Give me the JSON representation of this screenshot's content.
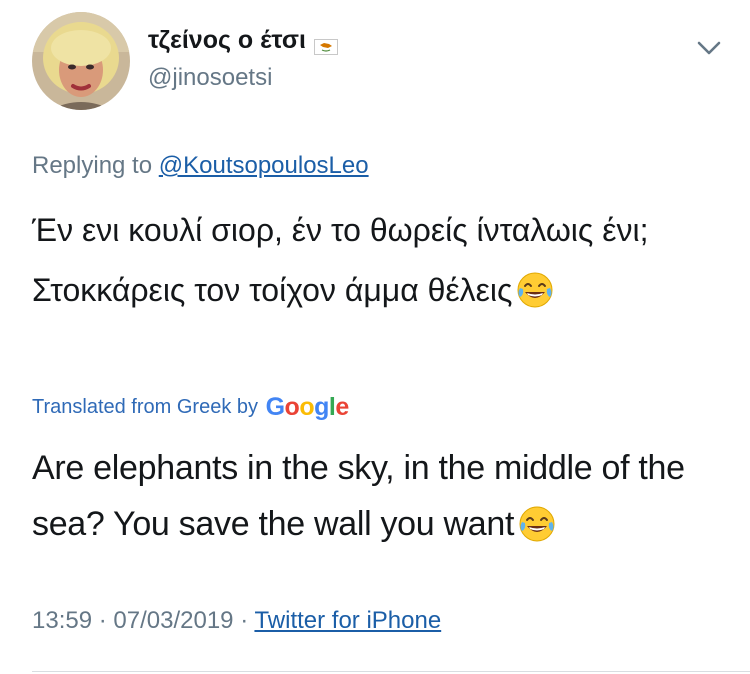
{
  "author": {
    "display_name": "τζείνος ο έτσι",
    "handle": "@jinosoetsi",
    "avatar_icon": "user-avatar",
    "flag_icon": "cyprus-flag-icon"
  },
  "menu": {
    "icon": "chevron-down-icon"
  },
  "reply": {
    "prefix": "Replying to",
    "to_handle": "@KoutsopoulosLeo"
  },
  "tweet": {
    "text": "Έν ενι κουλί σιορ, έν το θωρείς ίνταλωις ένι; Στοκκάρεις τον τοίχον άμμα θέλεις",
    "emoji_icon": "face-with-tears-of-joy-emoji"
  },
  "translation": {
    "label": "Translated from Greek by",
    "provider": "Google",
    "text": "Are elephants in the sky, in the middle of the sea? You save the wall you want",
    "emoji_icon": "face-with-tears-of-joy-emoji"
  },
  "meta": {
    "time": "13:59",
    "date": "07/03/2019",
    "separator": "·",
    "source": "Twitter for iPhone"
  },
  "colors": {
    "text": "#14171a",
    "secondary": "#657786",
    "link": "#1b5ea7",
    "translation_label": "#2f6ab7"
  }
}
